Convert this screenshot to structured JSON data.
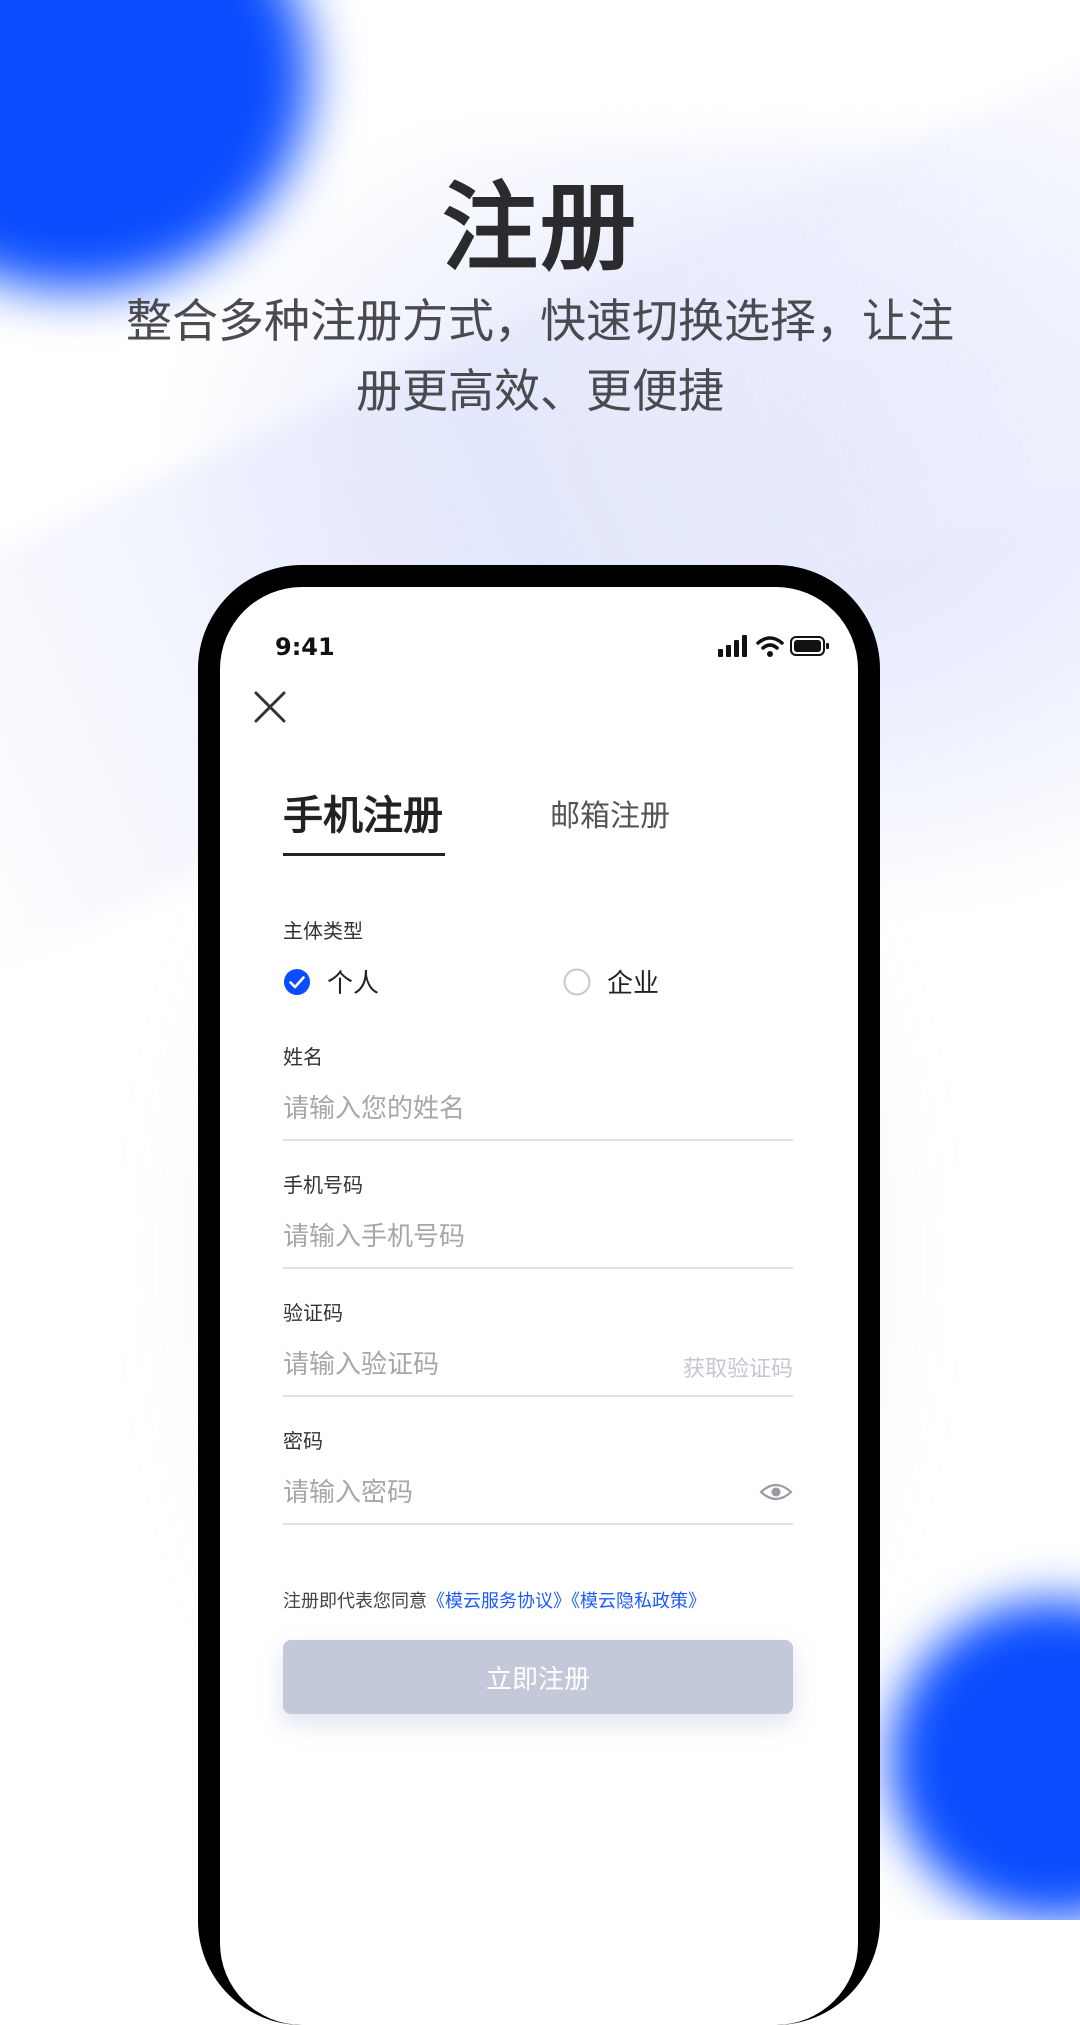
{
  "hero": {
    "title": "注册",
    "subtitle_line1": "整合多种注册方式，快速切换选择，让注",
    "subtitle_line2": "册更高效、更便捷"
  },
  "status_bar": {
    "time": "9:41",
    "icons": [
      "signal-icon",
      "wifi-icon",
      "battery-icon"
    ]
  },
  "tabs": [
    {
      "label": "手机注册",
      "active": true
    },
    {
      "label": "邮箱注册",
      "active": false
    }
  ],
  "form": {
    "entity_type": {
      "label": "主体类型",
      "options": [
        {
          "label": "个人",
          "checked": true
        },
        {
          "label": "企业",
          "checked": false
        }
      ]
    },
    "name": {
      "label": "姓名",
      "placeholder": "请输入您的姓名"
    },
    "phone": {
      "label": "手机号码",
      "placeholder": "请输入手机号码"
    },
    "code": {
      "label": "验证码",
      "placeholder": "请输入验证码",
      "action": "获取验证码"
    },
    "password": {
      "label": "密码",
      "placeholder": "请输入密码"
    },
    "agreement": {
      "text": "注册即代表您同意",
      "link1": "《模云服务协议》",
      "link2": "《模云隐私政策》"
    },
    "submit_label": "立即注册"
  },
  "colors": {
    "accent": "#0a4dff",
    "link": "#1d5bff",
    "button_disabled": "#c4c9da"
  }
}
